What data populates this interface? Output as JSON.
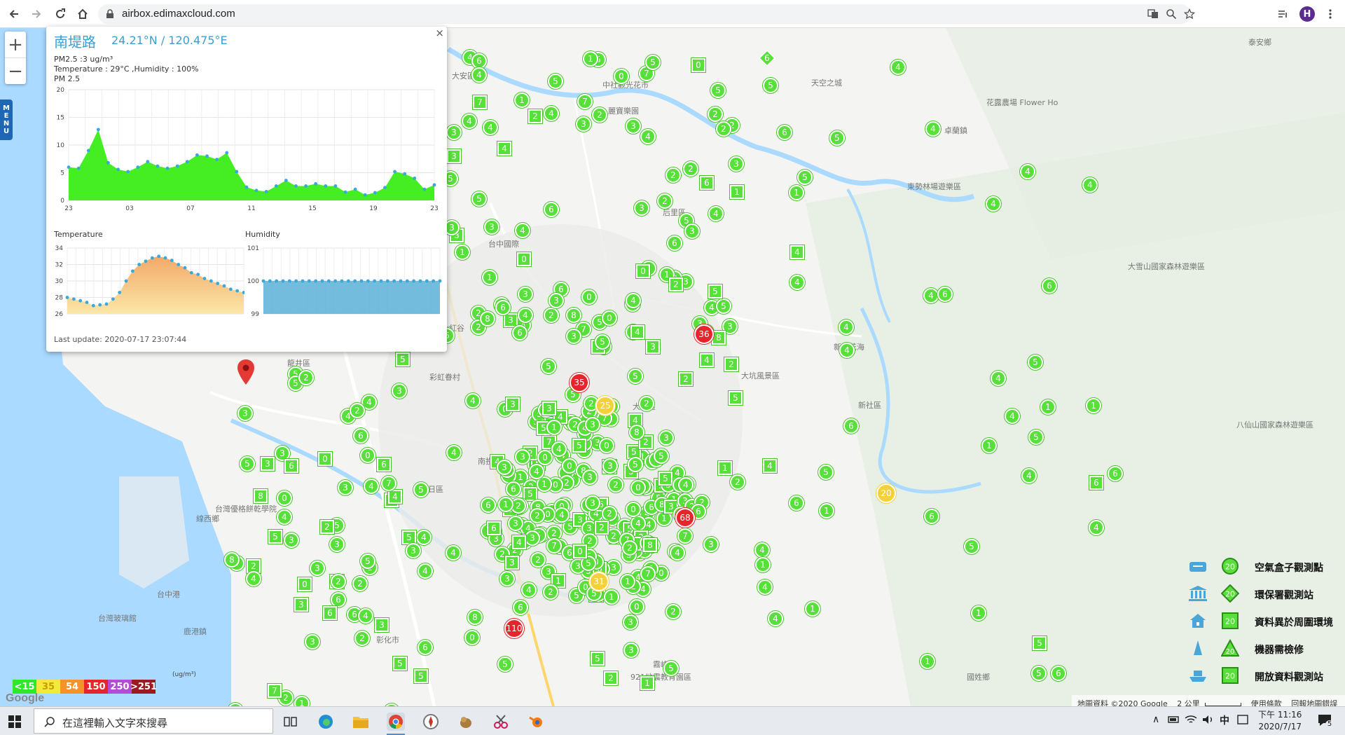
{
  "browser": {
    "url": "airbox.edimaxcloud.com",
    "avatar_letter": "H"
  },
  "map": {
    "zoom_in": "+",
    "zoom_out": "−",
    "menu": [
      "M",
      "E",
      "N",
      "U"
    ],
    "labels": [
      {
        "text": "大安區"
      },
      {
        "text": "后里區"
      },
      {
        "text": "中社觀光花市"
      },
      {
        "text": "麗寶樂園"
      },
      {
        "text": "天空之城"
      },
      {
        "text": "花露農場 Flower Ho"
      },
      {
        "text": "卓蘭鎮"
      },
      {
        "text": "泰安鄉"
      },
      {
        "text": "秋紅谷"
      },
      {
        "text": "彩虹眷村"
      },
      {
        "text": "台中國際"
      },
      {
        "text": "新社花海"
      },
      {
        "text": "新社區"
      },
      {
        "text": "大坑風景區"
      },
      {
        "text": "台灣優格餅乾學院"
      },
      {
        "text": "線西鄉"
      },
      {
        "text": "台中港"
      },
      {
        "text": "鹿港鎮"
      },
      {
        "text": "台灣玻璃館"
      },
      {
        "text": "烏日區"
      },
      {
        "text": "彰化市"
      },
      {
        "text": "大里區"
      },
      {
        "text": "霧峰區"
      },
      {
        "text": "921地震教育園區"
      },
      {
        "text": "國姓鄉"
      },
      {
        "text": "八仙山國家森林遊樂區"
      },
      {
        "text": "大雪山國家森林遊樂區"
      },
      {
        "text": "東勢林場遊樂區"
      },
      {
        "text": "龍井區"
      },
      {
        "text": "南投縣"
      }
    ]
  },
  "popup": {
    "close": "×",
    "site_name": "南堤路",
    "coords": "24.21°N / 120.475°E",
    "pm_line": "PM2.5 :3 ug/m³",
    "th_line": "Temperature : 29°C ,Humidity : 100%",
    "chart_title": "PM 2.5",
    "temp_label": "Temperature",
    "hum_label": "Humidity",
    "last_update": "Last update: 2020-07-17 23:07:44"
  },
  "chart_data": [
    {
      "type": "area",
      "title": "PM 2.5",
      "x_ticks": [
        "23",
        "03",
        "07",
        "11",
        "15",
        "19",
        "23"
      ],
      "y_ticks": [
        0,
        5,
        10,
        15,
        20
      ],
      "ylim": [
        0,
        20
      ],
      "color": "#44ee22",
      "point_color": "#3aa8d8",
      "values": [
        6,
        5.8,
        9,
        12.8,
        6.8,
        5.6,
        5.2,
        6,
        7,
        6.2,
        5.8,
        6.2,
        7,
        8.2,
        8,
        7.4,
        8.6,
        5.2,
        2.4,
        1.8,
        1.6,
        2.6,
        3.6,
        2.6,
        2.6,
        3,
        2.6,
        2.6,
        1.5,
        2,
        1,
        1.4,
        2.3,
        5.2,
        4.8,
        4,
        2,
        2.8
      ]
    },
    {
      "type": "area",
      "title": "Temperature",
      "y_ticks": [
        26,
        28,
        30,
        32,
        34
      ],
      "ylim": [
        26,
        34
      ],
      "color": "#f4c27a",
      "point_color": "#3aa8d8",
      "values": [
        28,
        27.8,
        27.6,
        27.4,
        27,
        27.1,
        27.2,
        27.8,
        28.6,
        30,
        31.2,
        32,
        32.4,
        32.8,
        33,
        32.8,
        32.5,
        32,
        31.6,
        31,
        30.8,
        30.3,
        30,
        29.7,
        29.4,
        29,
        28.8,
        28.6
      ]
    },
    {
      "type": "area",
      "title": "Humidity",
      "y_ticks": [
        99,
        100,
        101
      ],
      "ylim": [
        99,
        101
      ],
      "color": "#5cb0d8",
      "point_color": "#3aa8d8",
      "values": [
        100,
        100,
        100,
        100,
        100,
        100,
        100,
        100,
        100,
        100,
        100,
        100,
        100,
        100,
        100,
        100,
        100,
        100,
        100,
        100,
        100,
        100,
        100,
        100,
        100,
        100,
        100,
        100
      ]
    }
  ],
  "color_legend": {
    "unit": "(ug/m³)",
    "items": [
      {
        "label": "<15",
        "color": "#2ee82a"
      },
      {
        "label": "35",
        "color": "#f4e93a"
      },
      {
        "label": "54",
        "color": "#f5932a"
      },
      {
        "label": "150",
        "color": "#e6242b"
      },
      {
        "label": "250",
        "color": "#b34bd6"
      },
      {
        "label": ">251",
        "color": "#9b1a22"
      }
    ]
  },
  "symbol_legend": {
    "marker_value": "20",
    "items": [
      {
        "label": "空氣盒子觀測點",
        "icon": "airbox-icon",
        "marker": "circle"
      },
      {
        "label": "環保署觀測站",
        "icon": "epa-building-icon",
        "marker": "diamond"
      },
      {
        "label": "資料異於周圍環境",
        "icon": "house-icon",
        "marker": "square"
      },
      {
        "label": "機器需檢修",
        "icon": "cone-icon",
        "marker": "triangle"
      },
      {
        "label": "開放資料觀測站",
        "icon": "boat-icon",
        "marker": "square"
      }
    ]
  },
  "attribution": {
    "data": "地圖資料 ©2020 Google",
    "scale": "2 公里",
    "terms": "使用條款",
    "report": "回報地圖錯誤"
  },
  "google_logo": "Google",
  "taskbar": {
    "search_placeholder": "在這裡輸入文字來搜尋",
    "ime": "中",
    "time": "下午 11:16",
    "date": "2020/7/17",
    "notif_count": "5"
  }
}
